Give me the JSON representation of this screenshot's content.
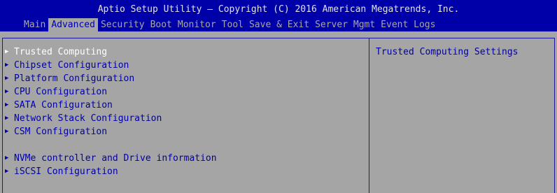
{
  "header": {
    "title": "Aptio Setup Utility – Copyright (C) 2016 American Megatrends, Inc."
  },
  "tabs": [
    {
      "label": "Main",
      "active": false
    },
    {
      "label": "Advanced",
      "active": true
    },
    {
      "label": "Security",
      "active": false
    },
    {
      "label": "Boot",
      "active": false
    },
    {
      "label": "Monitor",
      "active": false
    },
    {
      "label": "Tool",
      "active": false
    },
    {
      "label": "Save & Exit",
      "active": false
    },
    {
      "label": "Server Mgmt",
      "active": false
    },
    {
      "label": "Event Logs",
      "active": false
    }
  ],
  "menu": {
    "items": [
      {
        "label": "Trusted Computing",
        "selected": true
      },
      {
        "label": "Chipset Configuration",
        "selected": false
      },
      {
        "label": "Platform Configuration",
        "selected": false
      },
      {
        "label": "CPU Configuration",
        "selected": false
      },
      {
        "label": "SATA Configuration",
        "selected": false
      },
      {
        "label": "Network Stack Configuration",
        "selected": false
      },
      {
        "label": "CSM Configuration",
        "selected": false
      },
      {
        "label": "NVMe controller and Drive information",
        "selected": false
      },
      {
        "label": "iSCSI Configuration",
        "selected": false
      }
    ]
  },
  "help": {
    "text": "Trusted Computing Settings"
  },
  "icons": {
    "submenu_arrow": "triangle-right-icon"
  },
  "colors": {
    "header_bg": "#0000a8",
    "panel_bg": "#a5a5a5",
    "text": "#0000a8",
    "selected_text": "#ffffff",
    "tab_text": "#a7a7a7",
    "border": "#1a1a94"
  }
}
